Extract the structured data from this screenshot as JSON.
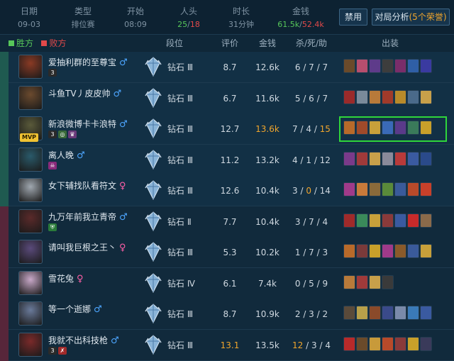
{
  "summary": {
    "date": {
      "label": "日期",
      "value": "09-03"
    },
    "type": {
      "label": "类型",
      "value": "排位赛"
    },
    "start": {
      "label": "开始",
      "value": "08:09"
    },
    "kills": {
      "label": "人头",
      "win": "25",
      "sep": "/",
      "lose": "18"
    },
    "duration": {
      "label": "时长",
      "value": "31分钟"
    },
    "gold": {
      "label": "金钱",
      "win": "61.5k",
      "sep": "/",
      "lose": "52.4k"
    }
  },
  "buttons": {
    "ban": "禁用",
    "analysis": "对局分析",
    "analysis_badge": "(5个荣誉)"
  },
  "colors": {
    "win": "#57c75a",
    "lose": "#e2494a",
    "highlight": "#f0a52c",
    "mvp_outline": "#2fd63b"
  },
  "header": {
    "win_legend": "胜方",
    "lose_legend": "败方",
    "rank": "段位",
    "score": "评价",
    "gold": "金钱",
    "kda": "杀/死/助",
    "items": "出装"
  },
  "players": [
    {
      "name": "爱抽利群的至尊宝",
      "gender": "♂",
      "team": "win",
      "rank": "钻石 Ⅲ",
      "score": "8.7",
      "gold": "12.6k",
      "k": "6",
      "d": "7",
      "a": "7",
      "tags": [
        "3"
      ],
      "champ_color": "#8a3a24",
      "items": [
        "#6a4a2a",
        "#b84e6e",
        "#5e3b8a",
        "#3d3d3d",
        "#7a2d6a",
        "#2f5fa6",
        "#3a3aa0"
      ]
    },
    {
      "name": "斗鱼TV丿皮皮帅",
      "gender": "♂",
      "team": "win",
      "rank": "钻石 Ⅲ",
      "score": "6.7",
      "gold": "11.6k",
      "k": "5",
      "d": "6",
      "a": "7",
      "tags": [],
      "champ_color": "#6b4a2e",
      "items": [
        "#9a2a2a",
        "#7a8a9a",
        "#b87a3a",
        "#a03a2a",
        "#b88a2a",
        "#4a6a8a",
        "#c8a04a"
      ]
    },
    {
      "name": "新浪微博卡卡浪特",
      "gender": "♂",
      "team": "win",
      "rank": "钻石 Ⅲ",
      "score": "12.7",
      "gold": "13.6k",
      "k": "7",
      "d": "4",
      "a": "15",
      "mvp": "MVP",
      "tags": [
        "3",
        "◎",
        "♛"
      ],
      "champ_color": "#5a5a3a",
      "items": [
        "#b86a2a",
        "#a04a2a",
        "#c8a03a",
        "#3a6ab8",
        "#5a3a8a",
        "#3a7a5a",
        "#c8a02a"
      ]
    },
    {
      "name": "离人晚",
      "gender": "♂",
      "team": "win",
      "rank": "钻石 Ⅲ",
      "score": "11.2",
      "gold": "13.2k",
      "k": "4",
      "d": "1",
      "a": "12",
      "tags": [
        "☠"
      ],
      "champ_color": "#2a5a6a",
      "items": [
        "#7a3a8a",
        "#a03a3a",
        "#c8a04a",
        "#8a8a9a",
        "#b83a3a",
        "#3a5aa0",
        "#2a4a8a"
      ]
    },
    {
      "name": "女下辅找队看符文",
      "gender": "♀",
      "team": "win",
      "rank": "钻石 Ⅲ",
      "score": "12.6",
      "gold": "10.4k",
      "k": "3",
      "d": "0",
      "a": "14",
      "tags": [],
      "champ_color": "#a0a8b0",
      "items": [
        "#a03a8a",
        "#c87a3a",
        "#8a6a3a",
        "#5a8a3a",
        "#3a5a9a",
        "#b84a2a",
        "#c8402a"
      ]
    },
    {
      "name": "九万年前我立青帝",
      "gender": "♂",
      "team": "lose",
      "rank": "钻石 Ⅱ",
      "score": "7.7",
      "gold": "10.4k",
      "k": "3",
      "d": "7",
      "a": "4",
      "tags": [
        "⛨"
      ],
      "champ_color": "#5a2a2a",
      "items": [
        "#a02a2a",
        "#3a8a5a",
        "#c8a03a",
        "#8a3a3a",
        "#3a5aa0",
        "#c82a2a",
        "#8a6a4a"
      ]
    },
    {
      "name": "请叫我巨根之王丶",
      "gender": "♀",
      "team": "lose",
      "rank": "钻石 Ⅲ",
      "score": "5.3",
      "gold": "10.2k",
      "k": "1",
      "d": "7",
      "a": "3",
      "tags": [],
      "champ_color": "#5a4a7a",
      "items": [
        "#b86a2a",
        "#7a3a3a",
        "#c8a02a",
        "#a03a8a",
        "#8a5a2a",
        "#3a5a9a",
        "#c8a03a"
      ]
    },
    {
      "name": "雪花兔",
      "gender": "♀",
      "team": "lose",
      "rank": "钻石 Ⅳ",
      "score": "6.1",
      "gold": "7.4k",
      "k": "0",
      "d": "5",
      "a": "9",
      "tags": [],
      "champ_color": "#c8a8c8",
      "items": [
        "#b87a3a",
        "#a03a3a",
        "#c8a04a",
        "#3a3a3a"
      ]
    },
    {
      "name": "等一个逝娜",
      "gender": "♂",
      "team": "lose",
      "rank": "钻石 Ⅲ",
      "score": "8.7",
      "gold": "10.9k",
      "k": "2",
      "d": "3",
      "a": "2",
      "tags": [],
      "champ_color": "#6a7a9a",
      "items": [
        "#5a4a3a",
        "#b8a04a",
        "#8a4a2a",
        "#3a4a8a",
        "#7a8aaa",
        "#3a7ab8",
        "#3a5aa0"
      ]
    },
    {
      "name": "我就不出科技枪",
      "gender": "♂",
      "team": "lose",
      "rank": "钻石 Ⅲ",
      "score": "13.1",
      "gold": "13.5k",
      "k": "12",
      "d": "3",
      "a": "4",
      "tags": [
        "3",
        "✗"
      ],
      "champ_color": "#7a2a2a",
      "items": [
        "#b82a2a",
        "#6a4a2a",
        "#c89a3a",
        "#b84a2a",
        "#8a3a3a",
        "#c8a02a",
        "#3a3a5a"
      ]
    }
  ]
}
